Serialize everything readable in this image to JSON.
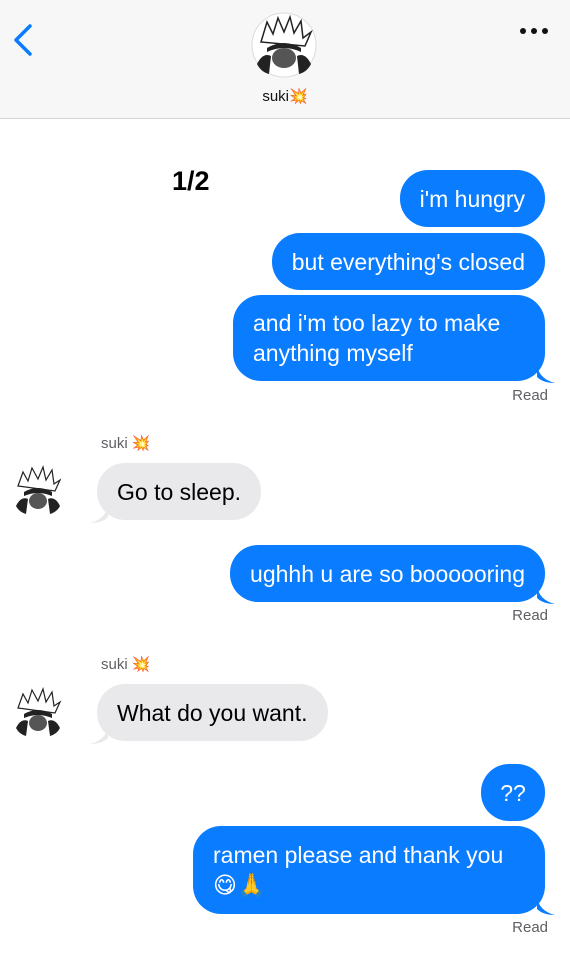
{
  "header": {
    "contact_name": "suki",
    "contact_emoji": "💥",
    "back_icon": "chevron-left-icon",
    "more_icon": "ellipsis-icon"
  },
  "overlay_label": "1/2",
  "messages": [
    {
      "dir": "out",
      "text": "i'm hungry"
    },
    {
      "dir": "out",
      "text": "but everything's closed"
    },
    {
      "dir": "out",
      "text": "and i'm too lazy to make anything myself"
    },
    {
      "dir": "status",
      "text": "Read"
    },
    {
      "dir": "sender",
      "text": "suki 💥"
    },
    {
      "dir": "in",
      "text": "Go to sleep."
    },
    {
      "dir": "out",
      "text": "ughhh u are so boooooring"
    },
    {
      "dir": "status",
      "text": "Read"
    },
    {
      "dir": "sender",
      "text": "suki 💥"
    },
    {
      "dir": "in",
      "text": "What do you want."
    },
    {
      "dir": "out",
      "text": "??"
    },
    {
      "dir": "out",
      "text": "ramen please and thank you 😋🙏"
    },
    {
      "dir": "status",
      "text": "Read"
    }
  ],
  "colors": {
    "outgoing": "#0a7cff",
    "incoming": "#e9e9eb",
    "accent": "#0a7cff"
  }
}
